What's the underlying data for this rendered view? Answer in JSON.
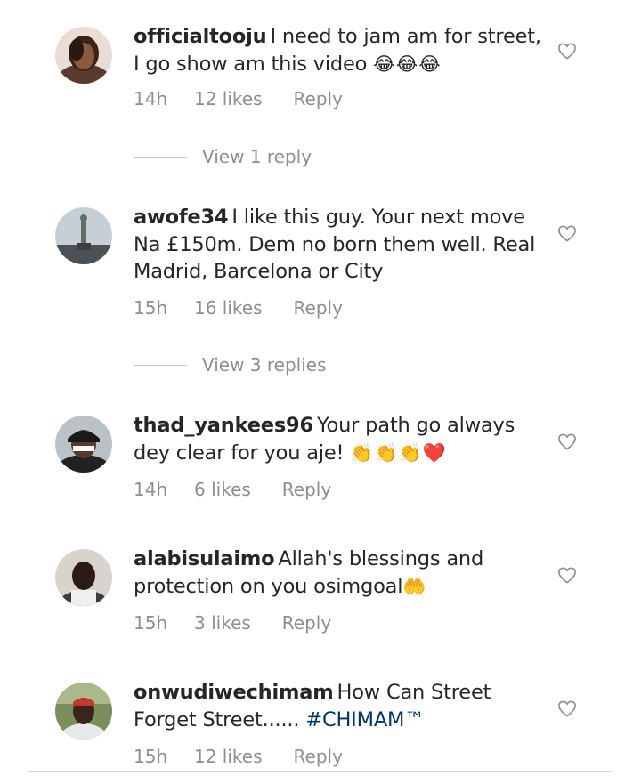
{
  "comments": [
    {
      "username": "officialtooju",
      "text": "I need to jam am for street, I go show am this video ",
      "emoji": "😂😂😂",
      "hashtag": "",
      "time": "14h",
      "likes": "12 likes",
      "reply_label": "Reply",
      "view_replies": "View 1 reply"
    },
    {
      "username": "awofe34",
      "text": "I like this guy. Your next move Na £150m. Dem no born them well. Real Madrid, Barcelona or City",
      "emoji": "",
      "hashtag": "",
      "time": "15h",
      "likes": "16 likes",
      "reply_label": "Reply",
      "view_replies": "View 3 replies"
    },
    {
      "username": "thad_yankees96",
      "text": "Your path go always dey clear for you aje! ",
      "emoji": "👏👏👏❤️",
      "hashtag": "",
      "time": "14h",
      "likes": "6 likes",
      "reply_label": "Reply",
      "view_replies": ""
    },
    {
      "username": "alabisulaimo",
      "text": "Allah's blessings and protection on you osimgoal",
      "emoji": "🤲",
      "hashtag": "",
      "time": "15h",
      "likes": "3 likes",
      "reply_label": "Reply",
      "view_replies": ""
    },
    {
      "username": "onwudiwechimam",
      "text": "How Can Street Forget Street...... ",
      "emoji": "",
      "hashtag": "#CHIMAM™",
      "time": "15h",
      "likes": "12 likes",
      "reply_label": "Reply",
      "view_replies": ""
    }
  ],
  "icons": {
    "like": "heart-outline-icon",
    "avatar": "avatar-photo"
  },
  "colors": {
    "text": "#262626",
    "secondary": "#8e8e8e",
    "hashtag": "#00376b",
    "divider": "#dbdbdb"
  }
}
